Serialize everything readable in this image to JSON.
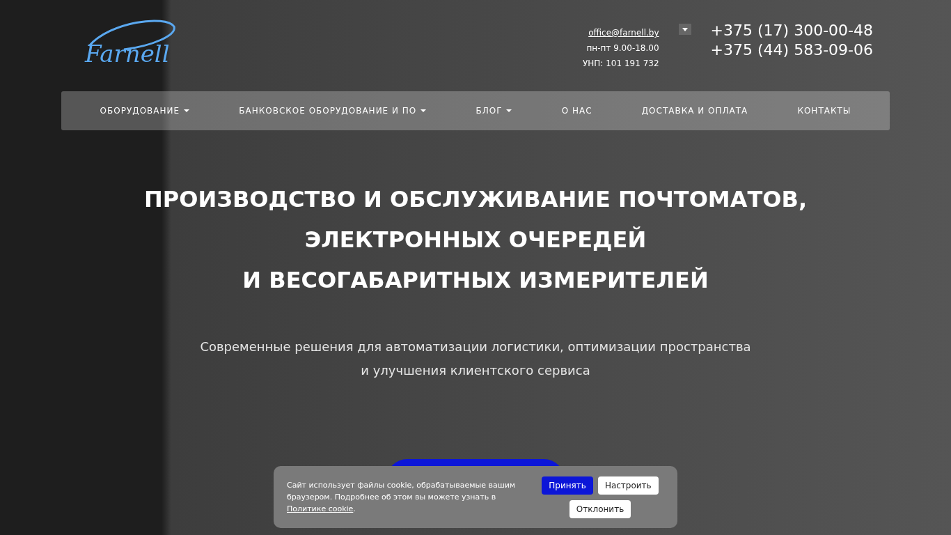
{
  "header": {
    "logo": "Farnell",
    "email": "office@farnell.by",
    "hours": "пн-пт 9.00-18.00",
    "unp": "УНП: 101 191 732",
    "phones": [
      "+375 (17) 300-00-48",
      "+375 (44) 583-09-06"
    ]
  },
  "nav": [
    {
      "label": "ОБОРУДОВАНИЕ",
      "has_dropdown": true
    },
    {
      "label": "БАНКОВСКОЕ ОБОРУДОВАНИЕ И ПО",
      "has_dropdown": true
    },
    {
      "label": "БЛОГ",
      "has_dropdown": true
    },
    {
      "label": "О НАС",
      "has_dropdown": false
    },
    {
      "label": "ДОСТАВКА И ОПЛАТА",
      "has_dropdown": false
    },
    {
      "label": "КОНТАКТЫ",
      "has_dropdown": false
    }
  ],
  "hero": {
    "title_lines": [
      "ПРОИЗВОДСТВО И ОБСЛУЖИВАНИЕ ПОЧТОМАТОВ,",
      "ЭЛЕКТРОННЫХ ОЧЕРЕДЕЙ",
      "И ВЕСОГАБАРИТНЫХ ИЗМЕРИТЕЛЕЙ"
    ],
    "subtitle_lines": [
      "Современные решения для автоматизации логистики, оптимизации пространства",
      "и улучшения клиентского сервиса"
    ]
  },
  "cookie_banner": {
    "text": "Сайт использует файлы cookie, обрабатываемые вашим браузером. Подробнее об этом вы можете узнать в",
    "link": "Политике cookie",
    "tail": ".",
    "buttons": [
      {
        "label": "Принять",
        "kind": "primary"
      },
      {
        "label": "Настроить",
        "kind": "secondary"
      },
      {
        "label": "Отклонить",
        "kind": "secondary"
      }
    ]
  }
}
